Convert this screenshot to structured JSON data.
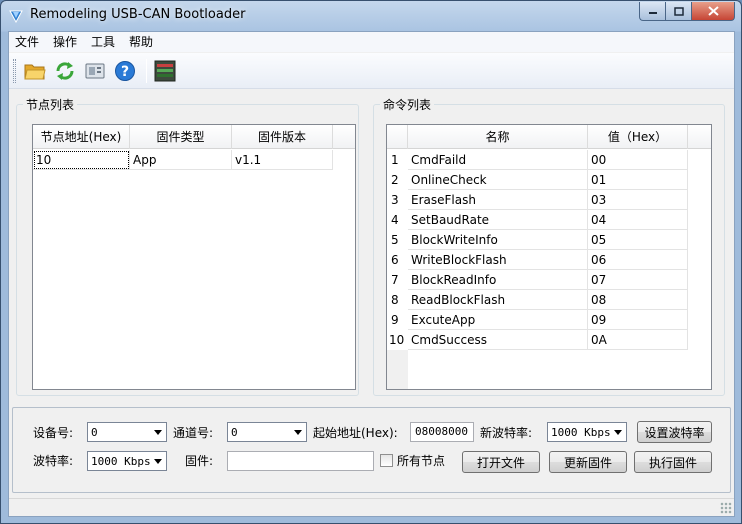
{
  "window": {
    "title": "Remodeling USB-CAN Bootloader"
  },
  "menu": {
    "items": [
      "文件",
      "操作",
      "工具",
      "帮助"
    ]
  },
  "toolbar": {
    "icons": [
      "open-folder-icon",
      "refresh-icon",
      "device-icon",
      "help-icon",
      "firmware-chip-icon"
    ]
  },
  "node_panel": {
    "title": "节点列表",
    "columns": [
      "节点地址(Hex)",
      "固件类型",
      "固件版本"
    ],
    "rows": [
      {
        "address": "10",
        "type": "App",
        "version": "v1.1"
      }
    ]
  },
  "cmd_panel": {
    "title": "命令列表",
    "columns": [
      "名称",
      "值（Hex）"
    ],
    "rows": [
      {
        "num": "1",
        "name": "CmdFaild",
        "value": "00"
      },
      {
        "num": "2",
        "name": "OnlineCheck",
        "value": "01"
      },
      {
        "num": "3",
        "name": "EraseFlash",
        "value": "03"
      },
      {
        "num": "4",
        "name": "SetBaudRate",
        "value": "04"
      },
      {
        "num": "5",
        "name": "BlockWriteInfo",
        "value": "05"
      },
      {
        "num": "6",
        "name": "WriteBlockFlash",
        "value": "06"
      },
      {
        "num": "7",
        "name": "BlockReadInfo",
        "value": "07"
      },
      {
        "num": "8",
        "name": "ReadBlockFlash",
        "value": "08"
      },
      {
        "num": "9",
        "name": "ExcuteApp",
        "value": "09"
      },
      {
        "num": "10",
        "name": "CmdSuccess",
        "value": "0A"
      }
    ]
  },
  "controls": {
    "device_label": "设备号:",
    "device_value": "0",
    "channel_label": "通道号:",
    "channel_value": "0",
    "start_addr_label": "起始地址(Hex):",
    "start_addr_value": "08008000",
    "new_baud_label": "新波特率:",
    "new_baud_value": "1000 Kbps",
    "set_baud_button": "设置波特率",
    "baud_label": "波特率:",
    "baud_value": "1000 Kbps",
    "firmware_label": "固件:",
    "firmware_value": "",
    "all_nodes_label": "所有节点",
    "all_nodes_checked": false,
    "open_file_button": "打开文件",
    "update_firmware_button": "更新固件",
    "execute_firmware_button": "执行固件"
  }
}
